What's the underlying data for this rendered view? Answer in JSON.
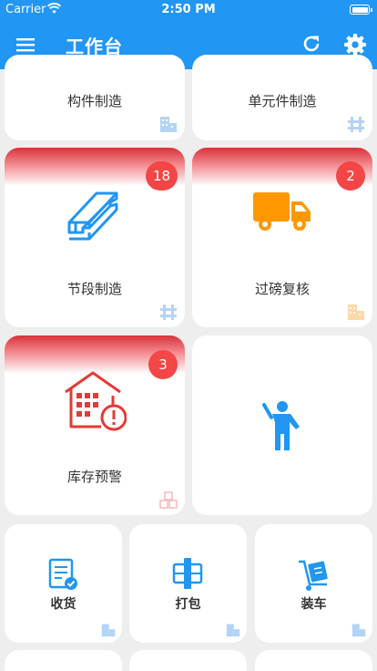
{
  "status_bar": {
    "carrier": "Carrier",
    "time": "2:50 PM"
  },
  "app_bar": {
    "title": "工作台",
    "icons": [
      "menu-icon",
      "refresh-icon",
      "settings-icon"
    ]
  },
  "colors": {
    "primary": "#2196f3",
    "badge": "#f44646",
    "alert_red": "#d9323a",
    "orange": "#ff9800",
    "warning_red": "#e53935"
  },
  "tiles": {
    "component": {
      "label": "构件制造",
      "icon": "building-icon"
    },
    "unit": {
      "label": "单元件制造",
      "icon": "structure-icon"
    },
    "segment": {
      "label": "节段制造",
      "badge": "18",
      "icon": "steel-beam-icon"
    },
    "weigh": {
      "label": "过磅复核",
      "badge": "2",
      "icon": "truck-icon"
    },
    "inventory": {
      "label": "库存预警",
      "badge": "3",
      "icon": "warehouse-alert-icon"
    },
    "person": {
      "icon": "person-waving-icon"
    },
    "receive": {
      "label": "收货",
      "icon": "receipt-check-icon"
    },
    "pack": {
      "label": "打包",
      "icon": "package-icon"
    },
    "load": {
      "label": "装车",
      "icon": "hand-truck-icon"
    }
  }
}
